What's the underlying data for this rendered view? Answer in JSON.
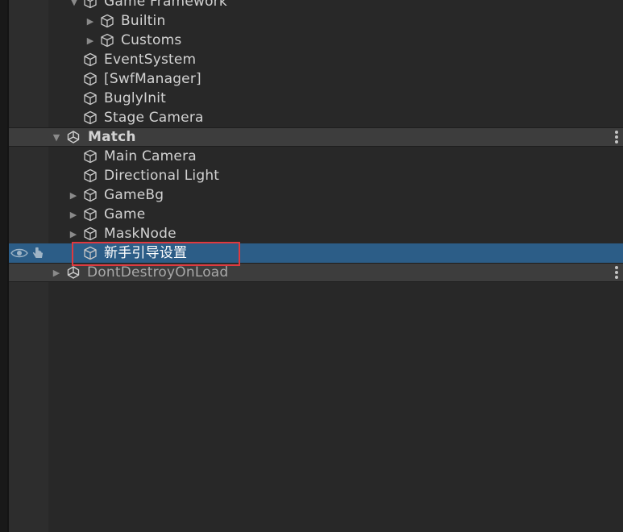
{
  "hierarchy": {
    "items": [
      {
        "label": "Game Framework",
        "type": "object",
        "expanded": true
      },
      {
        "label": "Builtin",
        "type": "object",
        "expanded": false
      },
      {
        "label": "Customs",
        "type": "object",
        "expanded": false
      },
      {
        "label": "EventSystem",
        "type": "object"
      },
      {
        "label": "[SwfManager]",
        "type": "object"
      },
      {
        "label": "BuglyInit",
        "type": "object"
      },
      {
        "label": "Stage Camera",
        "type": "object"
      },
      {
        "label": "Match",
        "type": "scene",
        "expanded": true
      },
      {
        "label": "Main Camera",
        "type": "object"
      },
      {
        "label": "Directional Light",
        "type": "object"
      },
      {
        "label": "GameBg",
        "type": "object",
        "expanded": false
      },
      {
        "label": "Game",
        "type": "object",
        "expanded": false
      },
      {
        "label": "MaskNode",
        "type": "object",
        "expanded": false
      },
      {
        "label": "新手引导设置",
        "type": "object",
        "selected": true
      },
      {
        "label": "DontDestroyOnLoad",
        "type": "scene",
        "expanded": false
      }
    ]
  },
  "colors": {
    "background": "#282828",
    "selection": "#2c5d87",
    "scene_header": "#3d3d3d",
    "highlight_box": "#e0393e"
  },
  "icons": {
    "game_object": "cube-icon",
    "scene": "unity-scene-icon",
    "visibility": "eye-icon",
    "pickable": "hand-icon",
    "menu": "kebab-menu-icon"
  }
}
